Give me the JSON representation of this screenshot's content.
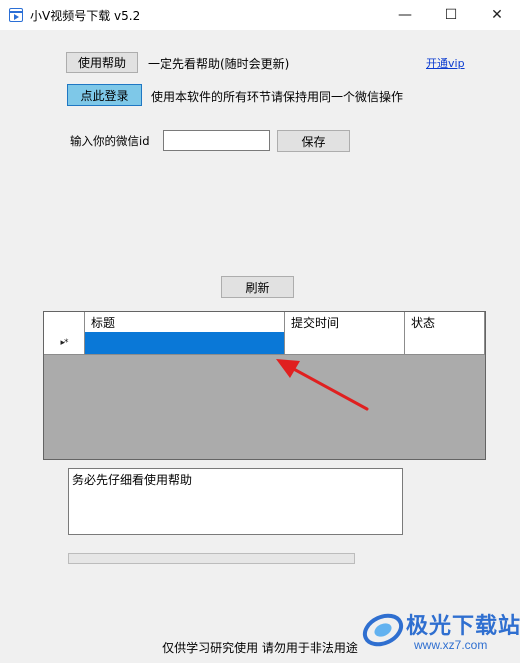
{
  "window": {
    "title": "小V视频号下载 v5.2",
    "controls": {
      "minimize": "—",
      "maximize": "☐",
      "close": "✕"
    }
  },
  "toolbar": {
    "help_button": "使用帮助",
    "help_note": "一定先看帮助(随时会更新)",
    "vip_link": "开通vip",
    "login_button": "点此登录",
    "login_note": "使用本软件的所有环节请保持用同一个微信操作"
  },
  "wechat": {
    "label": "输入你的微信id",
    "value": "",
    "save_button": "保存"
  },
  "refresh_button": "刷新",
  "table": {
    "columns": [
      "标题",
      "提交时间",
      "状态"
    ],
    "rows": [
      {
        "indicator": "▸*",
        "title": "",
        "time": "",
        "status": ""
      }
    ]
  },
  "log": {
    "text": "务必先仔细看使用帮助"
  },
  "progress": {
    "value": 0
  },
  "footer": {
    "text": "仅供学习研究使用 请勿用于非法用途"
  },
  "watermark": {
    "name": "极光下载站",
    "url": "www.xz7.com"
  },
  "colors": {
    "login_button": "#7ec8e8",
    "selection": "#0a78d7",
    "grid_bg": "#ababab",
    "link": "#0b3bd1",
    "arrow": "#e02020"
  }
}
